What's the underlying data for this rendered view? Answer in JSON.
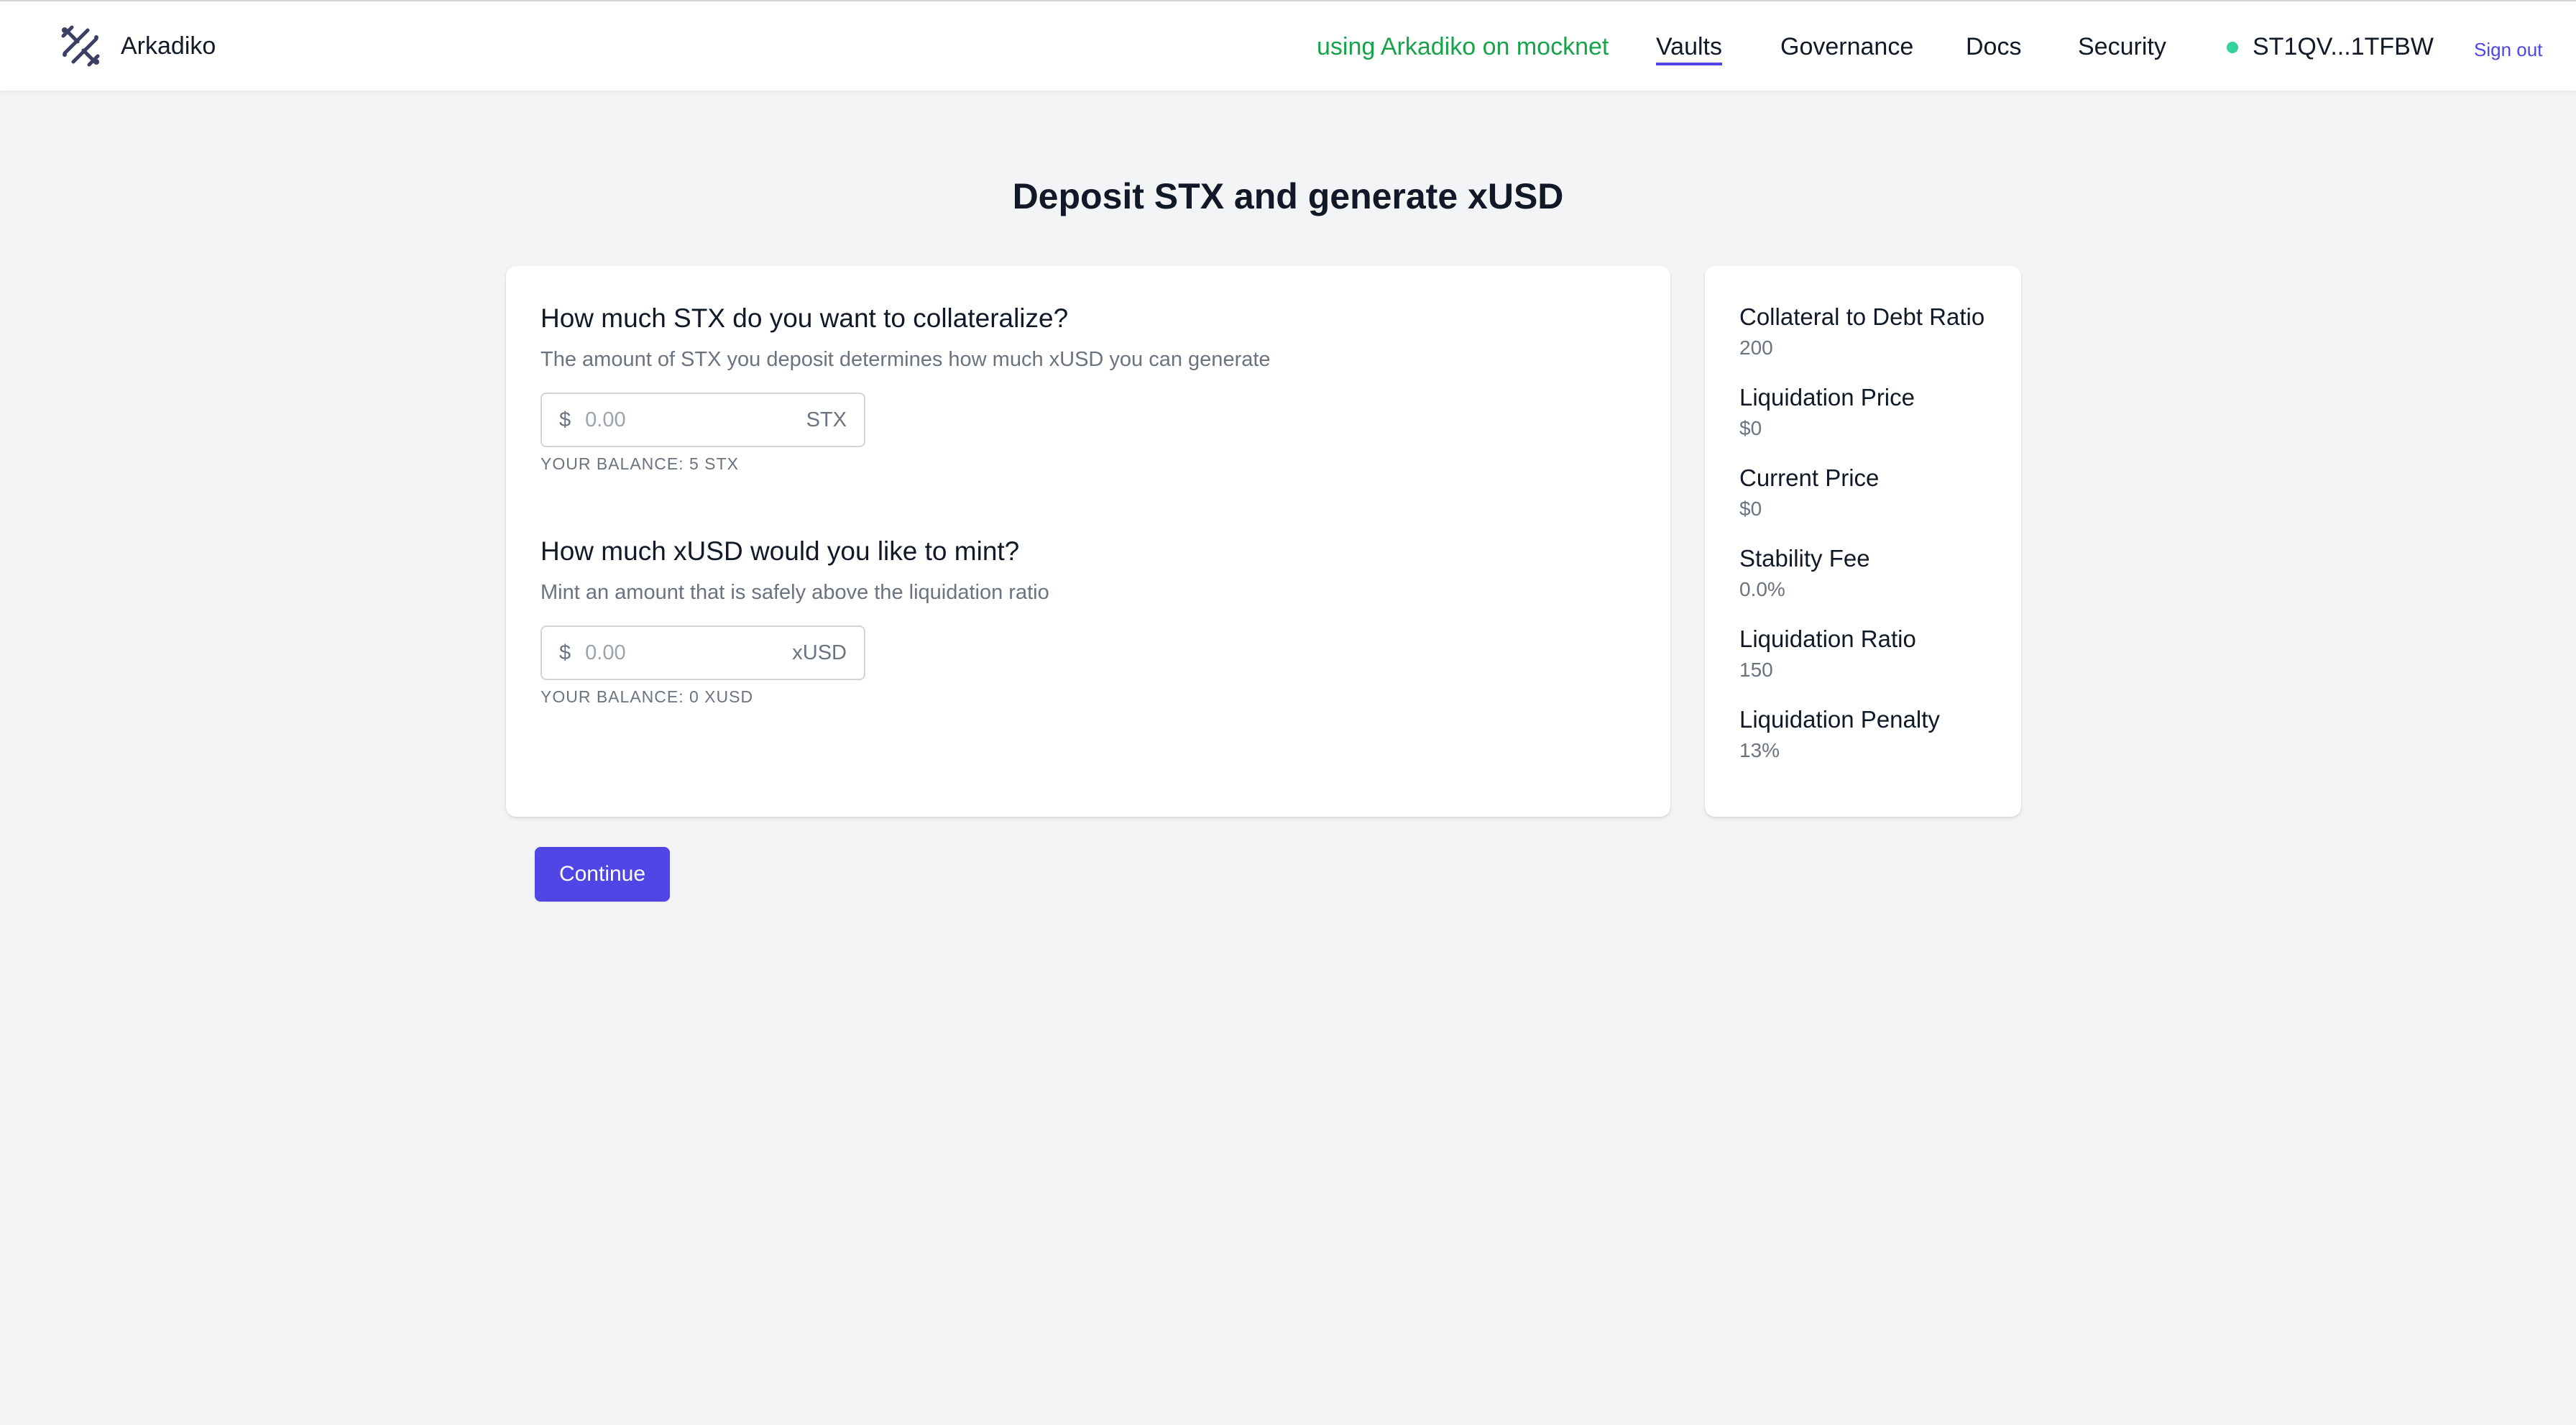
{
  "header": {
    "brand_name": "Arkadiko",
    "network_text": "using Arkadiko on mocknet",
    "nav_items": [
      {
        "label": "Vaults",
        "active": true
      },
      {
        "label": "Governance",
        "active": false
      },
      {
        "label": "Docs",
        "active": false
      },
      {
        "label": "Security",
        "active": false
      }
    ],
    "wallet_address": "ST1QV...1TFBW",
    "wallet_status_color": "#34d399",
    "sign_out_label": "Sign out",
    "network_color": "#16a34a",
    "accent_color": "#4f46e5"
  },
  "page": {
    "title": "Deposit STX and generate xUSD"
  },
  "collateral": {
    "heading": "How much STX do you want to collateralize?",
    "subtext": "The amount of STX you deposit determines how much xUSD you can generate",
    "currency_prefix": "$",
    "placeholder": "0.00",
    "unit": "STX",
    "balance": "YOUR BALANCE: 5 STX"
  },
  "mint": {
    "heading": "How much xUSD would you like to mint?",
    "subtext": "Mint an amount that is safely above the liquidation ratio",
    "currency_prefix": "$",
    "placeholder": "0.00",
    "unit": "xUSD",
    "balance": "YOUR BALANCE: 0 XUSD"
  },
  "stats": [
    {
      "label": "Collateral to Debt Ratio",
      "value": "200"
    },
    {
      "label": "Liquidation Price",
      "value": "$0"
    },
    {
      "label": "Current Price",
      "value": "$0"
    },
    {
      "label": "Stability Fee",
      "value": "0.0%"
    },
    {
      "label": "Liquidation Ratio",
      "value": "150"
    },
    {
      "label": "Liquidation Penalty",
      "value": "13%"
    }
  ],
  "actions": {
    "continue_label": "Continue"
  },
  "icons": {
    "brand_logo": "arkadiko-logo-icon",
    "wallet_status": "status-dot-icon"
  }
}
